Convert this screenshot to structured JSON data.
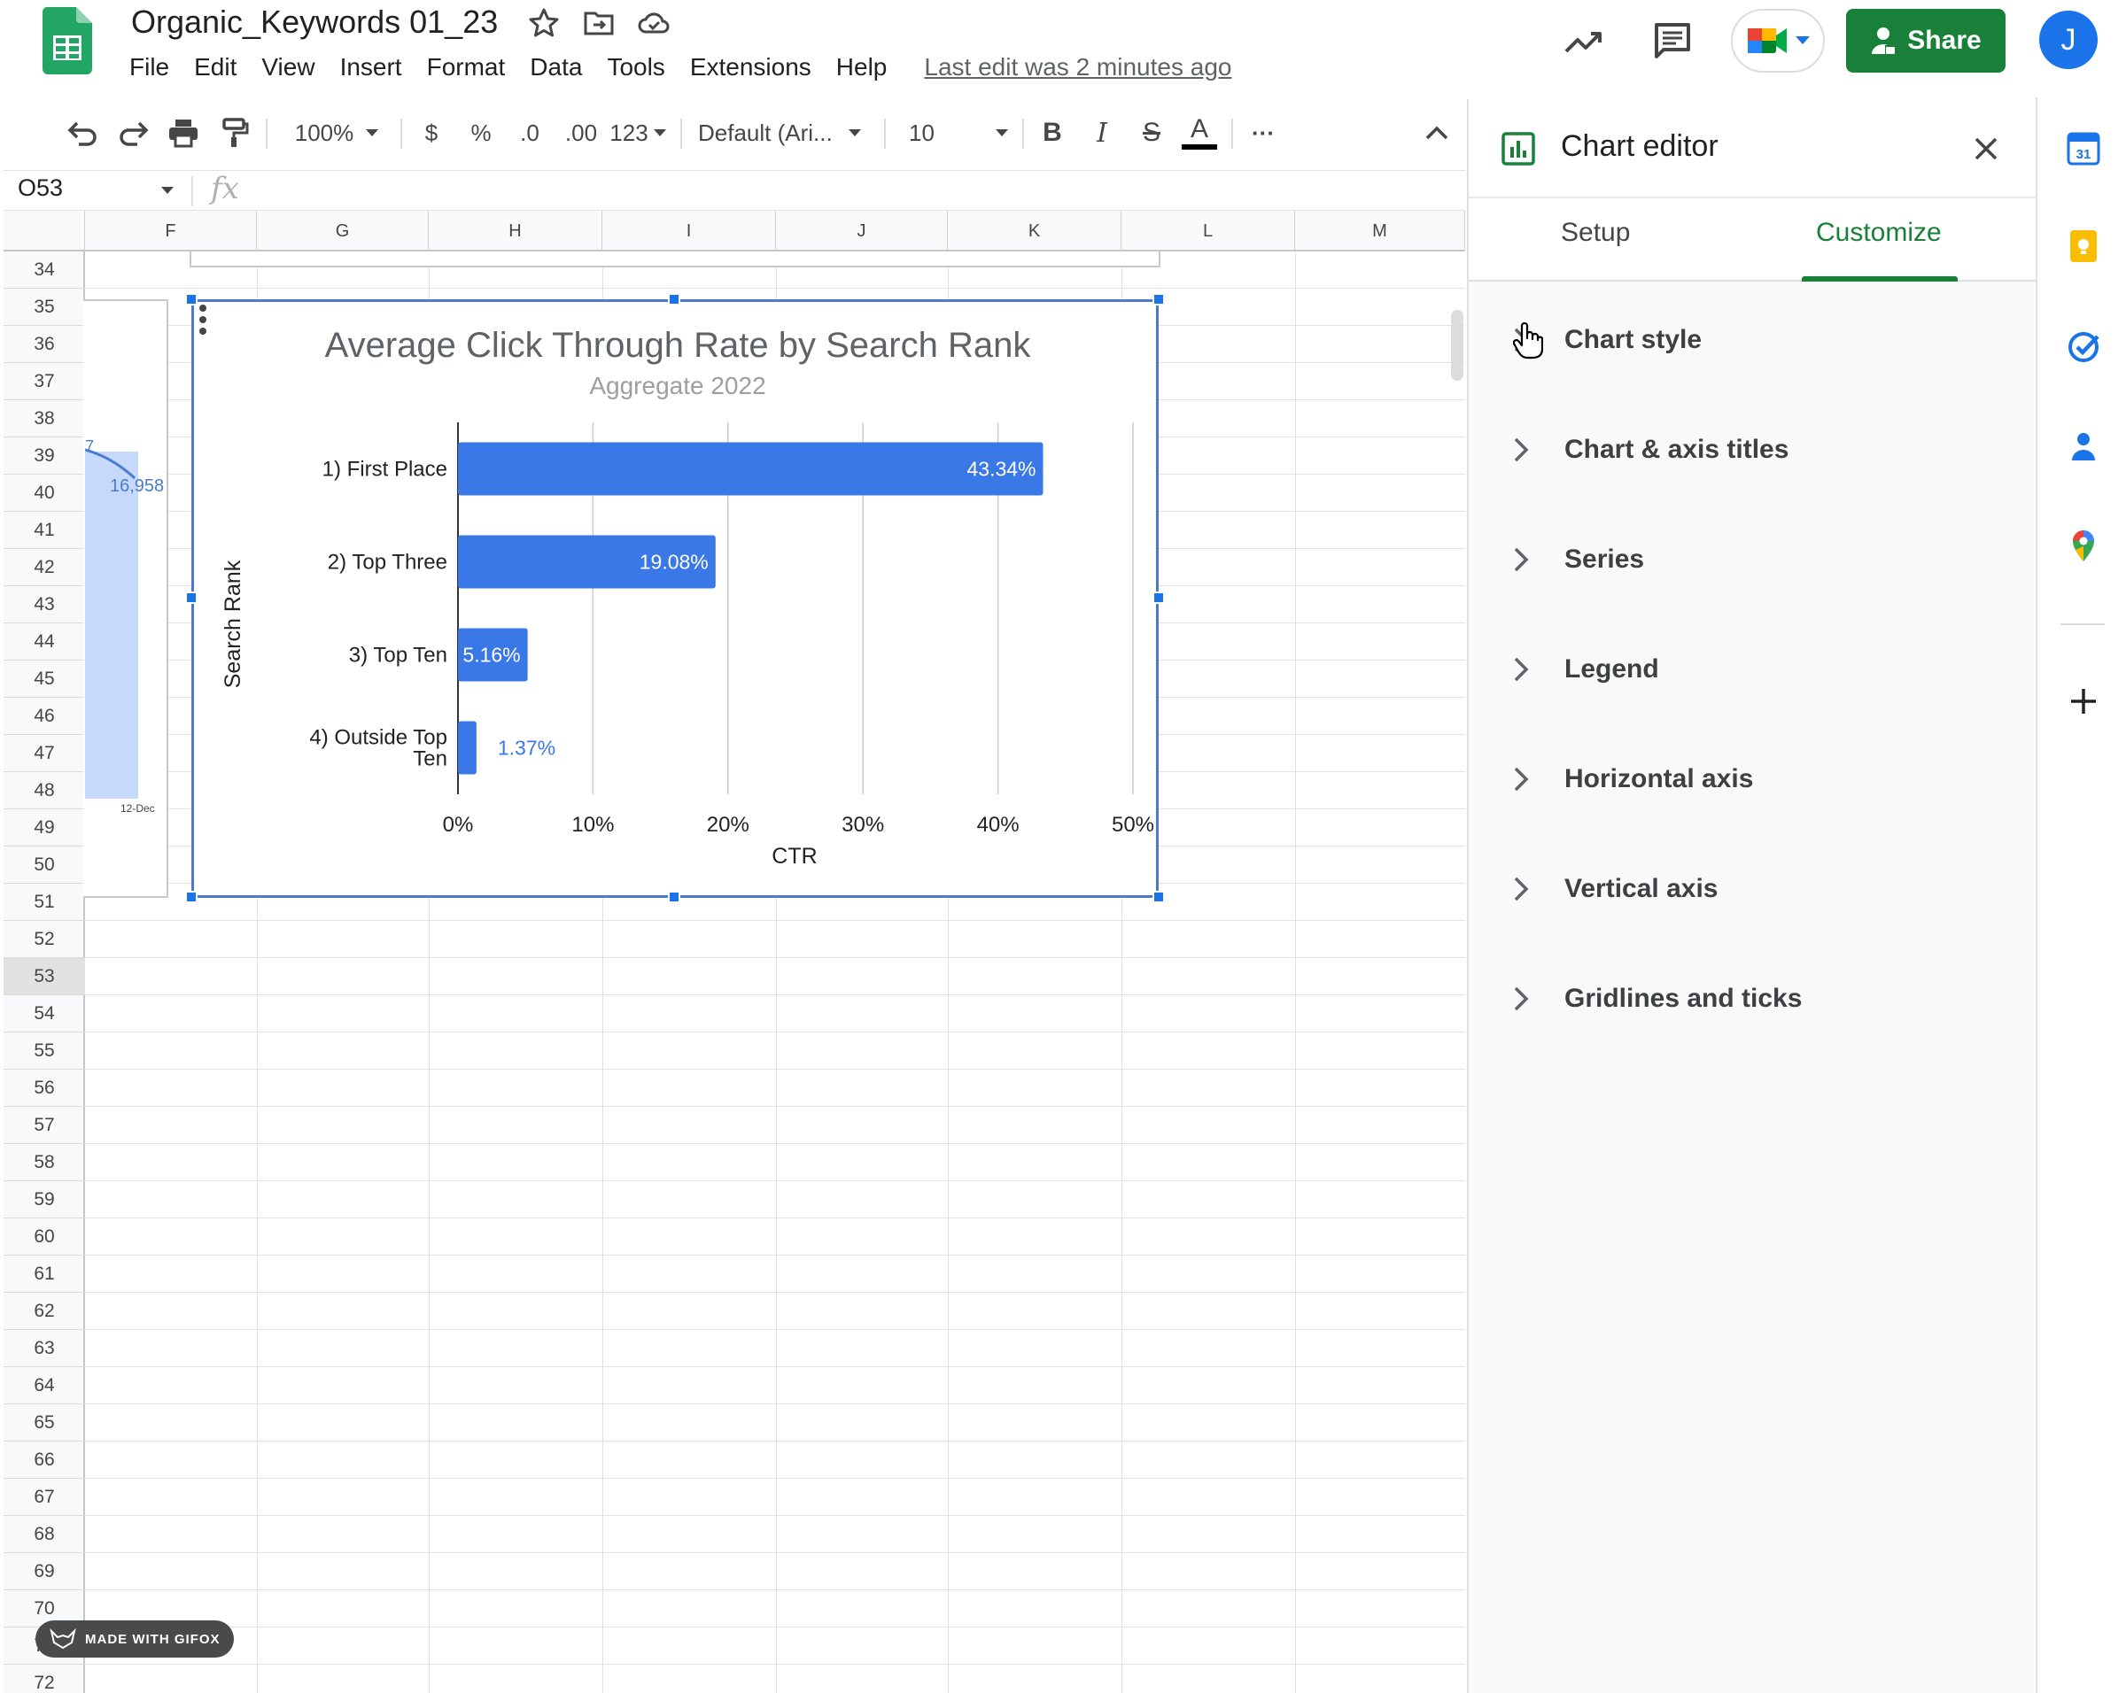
{
  "header": {
    "doc_title": "Organic_Keywords 01_23",
    "last_edit": "Last edit was 2 minutes ago",
    "menu": [
      "File",
      "Edit",
      "View",
      "Insert",
      "Format",
      "Data",
      "Tools",
      "Extensions",
      "Help"
    ],
    "share_label": "Share",
    "avatar_letter": "J"
  },
  "toolbar": {
    "zoom": "100%",
    "currency": "$",
    "percent": "%",
    "dec_decrease": ".0",
    "dec_increase": ".00",
    "number_format": "123",
    "font": "Default (Ari...",
    "font_size": "10",
    "bold": "B",
    "italic": "I",
    "strike": "S",
    "text_color": "A",
    "more": "···"
  },
  "formula": {
    "cell_ref": "O53",
    "fx": "fx"
  },
  "grid": {
    "columns": [
      "F",
      "G",
      "H",
      "I",
      "J",
      "K",
      "L",
      "M"
    ],
    "rows": [
      "34",
      "35",
      "36",
      "37",
      "38",
      "39",
      "40",
      "41",
      "42",
      "43",
      "44",
      "45",
      "46",
      "47",
      "48",
      "49",
      "50",
      "51",
      "52",
      "53",
      "54",
      "55",
      "56",
      "57",
      "58",
      "59",
      "60",
      "61",
      "62",
      "63",
      "64",
      "65",
      "66",
      "67",
      "68",
      "69",
      "70",
      "71",
      "72"
    ],
    "selected_row": "53",
    "left_chart_value": "16,958",
    "left_chart_value_partial": "7",
    "left_chart_date": "12-Dec"
  },
  "chart_data": {
    "type": "bar",
    "orientation": "horizontal",
    "title": "Average Click Through Rate by Search Rank",
    "subtitle": "Aggregate 2022",
    "xlabel": "CTR",
    "ylabel": "Search Rank",
    "categories": [
      "1) First Place",
      "2) Top Three",
      "3) Top Ten",
      "4) Outside Top Ten"
    ],
    "category_lines": [
      [
        "1) First Place"
      ],
      [
        "2) Top Three"
      ],
      [
        "3) Top Ten"
      ],
      [
        "4) Outside Top",
        "Ten"
      ]
    ],
    "values": [
      43.34,
      19.08,
      5.16,
      1.37
    ],
    "value_labels": [
      "43.34%",
      "19.08%",
      "5.16%",
      "1.37%"
    ],
    "xticks": [
      "0%",
      "10%",
      "20%",
      "30%",
      "40%",
      "50%"
    ],
    "xlim": [
      0,
      50
    ],
    "grid": true,
    "bar_color": "#3b78e7"
  },
  "editor": {
    "title": "Chart editor",
    "tabs": [
      "Setup",
      "Customize"
    ],
    "active_tab": "Customize",
    "sections": [
      "Chart style",
      "Chart & axis titles",
      "Series",
      "Legend",
      "Horizontal axis",
      "Vertical axis",
      "Gridlines and ticks"
    ]
  },
  "watermark": "MADE WITH GIFOX",
  "colors": {
    "accent_green": "#188038",
    "selection_blue": "#1a73e8"
  }
}
